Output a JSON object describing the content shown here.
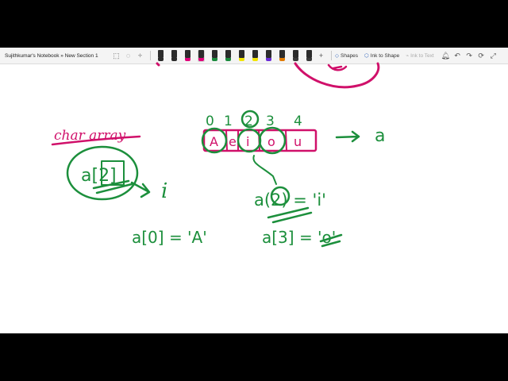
{
  "window": {
    "title": "Sujithkumar's Notebook » New Section 1"
  },
  "toolbar": {
    "pen_colors": [
      "#2b2b2b",
      "#2b2b2b",
      "#e0007a",
      "#e0007a",
      "#1a8a3c",
      "#1a8a3c",
      "#f2e400",
      "#f2e400",
      "#6a2bd8",
      "#e07a00",
      "#3a3a3a",
      "#3a3a3a"
    ],
    "selected_pen_index": 3,
    "shapes_label": "Shapes",
    "ink_to_shape_label": "Ink to Shape",
    "ink_to_text_label": "Ink to Text"
  },
  "ink": {
    "heading": "char array",
    "indices": [
      "0",
      "1",
      "2",
      "3",
      "4"
    ],
    "cells": [
      "A",
      "e",
      "i",
      "o",
      "u"
    ],
    "array_name": "a",
    "left_expr": "a[2]",
    "left_result": "i",
    "left_eq": "a[0] = 'A'",
    "right_eq1": "a(2) = 'i'",
    "right_eq2": "a[3] = 'o'",
    "colors": {
      "pink": "#d0106a",
      "green": "#1c8f3c"
    }
  }
}
